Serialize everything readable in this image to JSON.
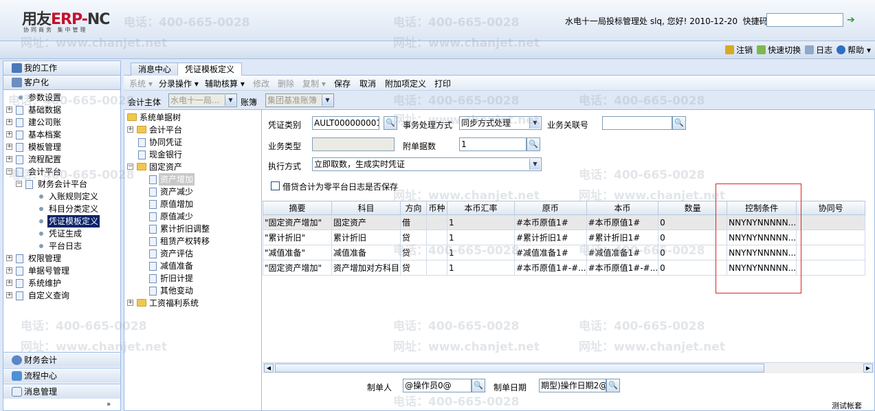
{
  "header": {
    "logo_text_1": "用友",
    "logo_text_2": "ERP-",
    "logo_text_3": "NC",
    "logo_sub": "协同商务  集中管理",
    "user_info": "水电十一局投标管理处 slq, 您好! 2010-12-20",
    "quickcode_label": "快捷码"
  },
  "top_links": {
    "logout": "注销",
    "quick_switch": "快速切换",
    "log": "日志",
    "help": "帮助"
  },
  "left_panel": {
    "my_work": "我的工作",
    "customize": "客户化",
    "tree": [
      {
        "label": "参数设置"
      },
      {
        "label": "基础数据"
      },
      {
        "label": "建公司账"
      },
      {
        "label": "基本档案"
      },
      {
        "label": "模板管理"
      },
      {
        "label": "流程配置"
      },
      {
        "label": "会计平台"
      },
      {
        "label": "财务会计平台"
      },
      {
        "label": "入账规则定义"
      },
      {
        "label": "科目分类定义"
      },
      {
        "label": "凭证模板定义"
      },
      {
        "label": "凭证生成"
      },
      {
        "label": "平台日志"
      },
      {
        "label": "权限管理"
      },
      {
        "label": "单据号管理"
      },
      {
        "label": "系统维护"
      },
      {
        "label": "自定义查询"
      }
    ],
    "bottom": [
      "财务会计",
      "流程中心",
      "消息管理"
    ]
  },
  "tabs": [
    "消息中心",
    "凭证模板定义"
  ],
  "opbar": {
    "system": "系统 ▾",
    "split_op": "分录操作 ▾",
    "aux": "辅助核算 ▾",
    "modify": "修改",
    "delete": "删除",
    "copy": "复制 ▾",
    "save": "保存",
    "cancel": "取消",
    "addon": "附加项定义",
    "print": "打印"
  },
  "entity": {
    "label": "会计主体",
    "value": "水电十一局...",
    "book_label": "账簿",
    "book_value": "集团基准账簿"
  },
  "subtree": [
    "系统单据树",
    "会计平台",
    "协同凭证",
    "现金银行",
    "固定资产",
    "资产增加",
    "资产减少",
    "原值增加",
    "原值减少",
    "累计折旧调整",
    "租赁产权转移",
    "资产评估",
    "减值准备",
    "折旧计提",
    "其他变动",
    "工资福利系统"
  ],
  "form": {
    "voucher_type_label": "凭证类别",
    "voucher_type_value": "AULT000000001\")",
    "process_mode_label": "事务处理方式",
    "process_mode_value": "同步方式处理",
    "biz_link_label": "业务关联号",
    "biz_link_value": "",
    "biz_type_label": "业务类型",
    "biz_type_value": "",
    "attach_label": "附单据数",
    "attach_value": "1",
    "exec_label": "执行方式",
    "exec_value": "立即取数，生成实时凭证",
    "checkbox_label": "借贷合计为零平台日志是否保存"
  },
  "table": {
    "columns": [
      "摘要",
      "科目",
      "方向",
      "币种",
      "本币汇率",
      "原币",
      "本币",
      "数量",
      "控制条件",
      "协同号"
    ],
    "rows": [
      [
        "\"固定资产增加\"",
        "固定资产",
        "借",
        "",
        "1",
        "#本币原值1#",
        "#本币原值1#",
        "0",
        "NNYNYNNNNN...",
        ""
      ],
      [
        "\"累计折旧\"",
        "累计折旧",
        "贷",
        "",
        "1",
        "#累计折旧1#",
        "#累计折旧1#",
        "0",
        "NNYNYNNNNN...",
        ""
      ],
      [
        "\"减值准备\"",
        "减值准备",
        "贷",
        "",
        "1",
        "#减值准备1#",
        "#减值准备1#",
        "0",
        "NNYNYNNNNN...",
        ""
      ],
      [
        "\"固定资产增加\"",
        "资产增加对方科目",
        "贷",
        "",
        "1",
        "#本币原值1#-#...",
        "#本币原值1#-#...",
        "0",
        "NNYNYNNNNN...",
        ""
      ]
    ]
  },
  "footer": {
    "maker_label": "制单人",
    "maker_value": "@操作员0@",
    "date_label": "制单日期",
    "date_value": "期型)操作日期2@"
  },
  "status_text": "测试帐套",
  "watermarks": {
    "phone": "电话：400-665-0028",
    "site": "网址：www.chanjet.net"
  },
  "colors": {
    "selection": "#0a246a",
    "highlight_box": "#e02020",
    "panel_border": "#99bbe8"
  }
}
